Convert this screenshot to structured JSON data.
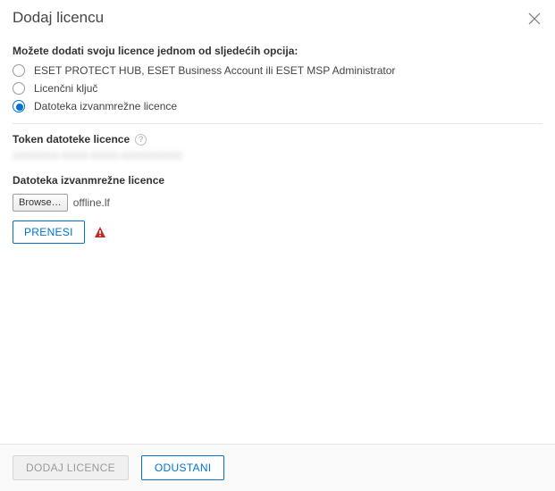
{
  "dialog": {
    "title": "Dodaj licencu"
  },
  "intro": {
    "heading": "Možete dodati svoju licence jednom od sljedećih opcija:"
  },
  "options": [
    {
      "id": "hub",
      "label": "ESET PROTECT HUB, ESET Business Account ili ESET MSP Administrator",
      "selected": false
    },
    {
      "id": "key",
      "label": "Licenčni ključ",
      "selected": false
    },
    {
      "id": "offline",
      "label": "Datoteka izvanmrežne licence",
      "selected": true
    }
  ],
  "token": {
    "label": "Token datoteke licence",
    "masked_value": "XXXXXXX-XXXX-XXXX-XXXXXXXXXX-XX"
  },
  "file": {
    "label": "Datoteka izvanmrežne licence",
    "browse_label": "Browse…",
    "filename": "offline.lf",
    "upload_label": "PRENESI"
  },
  "footer": {
    "primary_label": "DODAJ LICENCE",
    "secondary_label": "ODUSTANI"
  }
}
